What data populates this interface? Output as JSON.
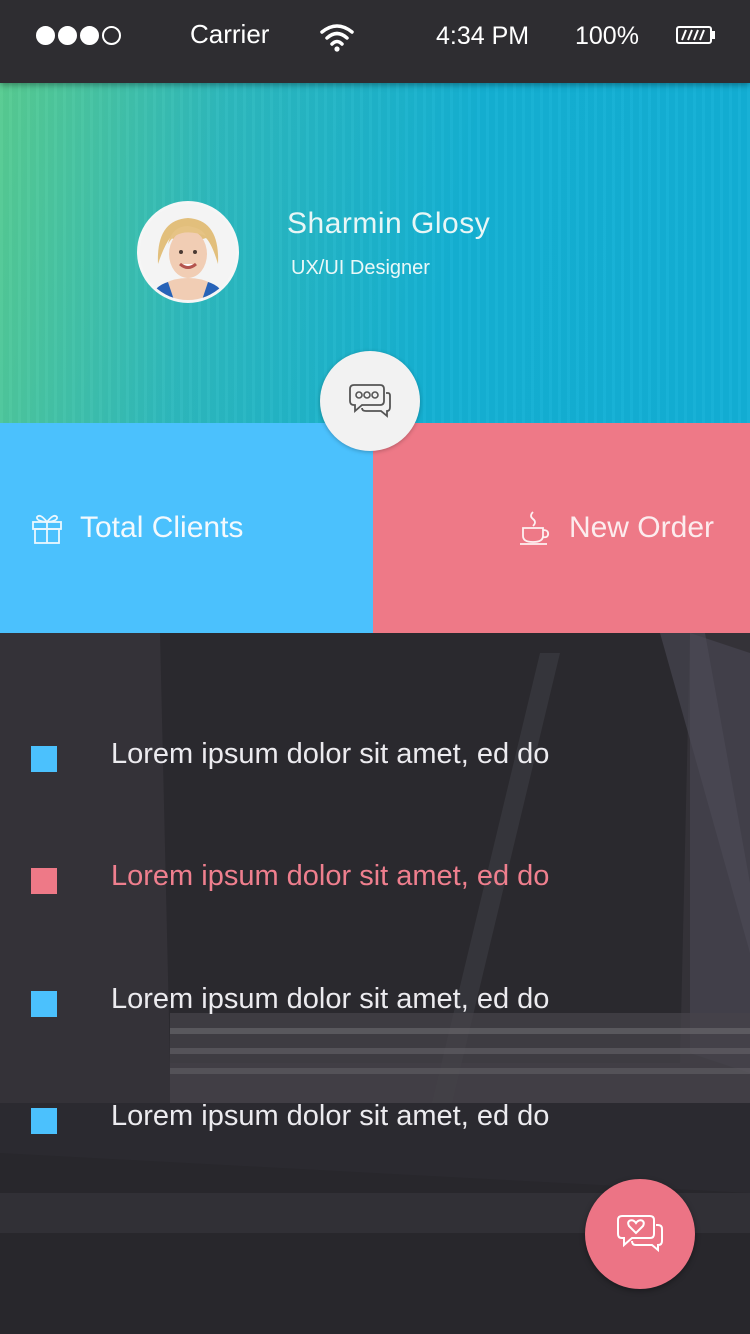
{
  "status_bar": {
    "signal_bars": [
      true,
      true,
      true,
      false
    ],
    "carrier": "Carrier",
    "time": "4:34 PM",
    "battery_percent": "100%",
    "wifi_icon": "wifi-icon",
    "battery_icon": "battery-icon"
  },
  "profile": {
    "name": "Sharmin  Glosy",
    "role": "UX/UI Designer"
  },
  "tiles": {
    "clients": {
      "label": "Total Clients",
      "icon": "gift-icon",
      "color": "#4bc1fd"
    },
    "order": {
      "label": "New Order",
      "icon": "coffee-cup-icon",
      "color": "#ee7987"
    }
  },
  "list": {
    "items": [
      {
        "text": "Lorem ipsum dolor sit amet, ed do",
        "bullet_color": "#4bc1fd",
        "highlighted": false
      },
      {
        "text": "Lorem ipsum dolor sit amet, ed do",
        "bullet_color": "#ee7987",
        "highlighted": true
      },
      {
        "text": "Lorem ipsum dolor sit amet, ed do",
        "bullet_color": "#4bc1fd",
        "highlighted": false
      },
      {
        "text": "Lorem ipsum dolor sit amet, ed do",
        "bullet_color": "#4bc1fd",
        "highlighted": false
      }
    ]
  },
  "colors": {
    "accent_blue": "#4bc1fd",
    "accent_pink": "#ee7987",
    "header_gradient_start": "#58cc91",
    "header_gradient_end": "#12afd6"
  }
}
